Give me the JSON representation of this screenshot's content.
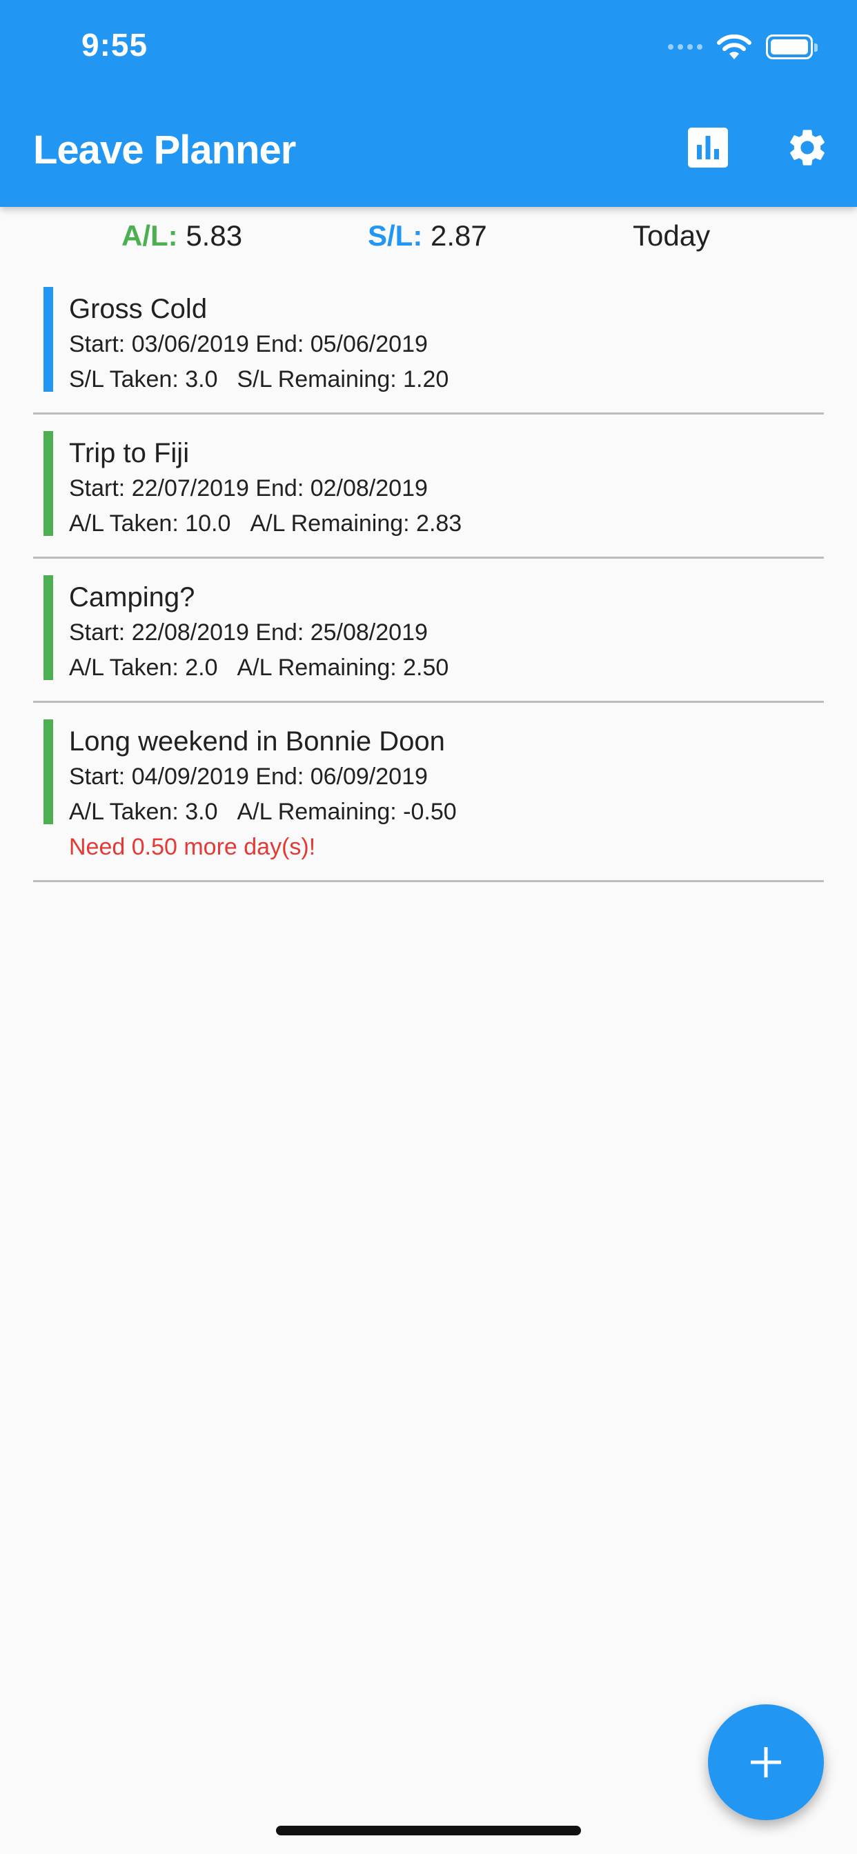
{
  "status_bar": {
    "time": "9:55"
  },
  "app_bar": {
    "title": "Leave Planner",
    "actions": [
      {
        "name": "stats",
        "icon": "bar-chart-icon"
      },
      {
        "name": "settings",
        "icon": "gear-icon"
      }
    ]
  },
  "summary": {
    "al_label": "A/L:",
    "al_value": "5.83",
    "sl_label": "S/L:",
    "sl_value": "2.87",
    "date_label": "Today"
  },
  "leaves": [
    {
      "title": "Gross Cold",
      "type": "sick",
      "color": "#2196f3",
      "start_text": "Start: 03/06/2019",
      "end_text": "End: 05/06/2019",
      "taken_text": "S/L Taken: 3.0",
      "remaining_text": "S/L Remaining: 1.20",
      "warning": ""
    },
    {
      "title": "Trip to Fiji",
      "type": "annual",
      "color": "#4caf50",
      "start_text": "Start: 22/07/2019",
      "end_text": "End: 02/08/2019",
      "taken_text": "A/L Taken: 10.0",
      "remaining_text": "A/L Remaining: 2.83",
      "warning": ""
    },
    {
      "title": "Camping?",
      "type": "annual",
      "color": "#4caf50",
      "start_text": "Start: 22/08/2019",
      "end_text": "End: 25/08/2019",
      "taken_text": "A/L Taken: 2.0",
      "remaining_text": "A/L Remaining: 2.50",
      "warning": ""
    },
    {
      "title": "Long weekend in Bonnie Doon",
      "type": "annual",
      "color": "#4caf50",
      "start_text": "Start: 04/09/2019",
      "end_text": "End: 06/09/2019",
      "taken_text": "A/L Taken: 3.0",
      "remaining_text": "A/L Remaining: -0.50",
      "warning": "Need 0.50 more day(s)!"
    }
  ],
  "fab": {
    "icon": "plus-icon"
  },
  "colors": {
    "primary": "#2196f3",
    "annual_leave": "#4caf50",
    "sick_leave": "#2196f3",
    "warning": "#e53935"
  }
}
